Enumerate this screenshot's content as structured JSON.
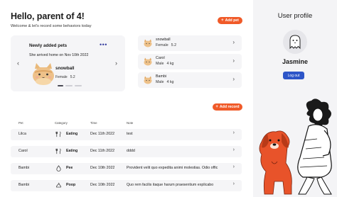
{
  "header": {
    "title": "Hello, parent of 4!",
    "subtitle": "Welcome & let's record some behaviors today",
    "add_pet_label": "Add pet"
  },
  "newly_added": {
    "title": "Newly added pets",
    "subtitle": "She arrived home on Nov 10th 2022",
    "pet_name": "snowball",
    "gender": "Female",
    "weight": "5.2",
    "icon": "cat-illustration"
  },
  "pets": [
    {
      "name": "snowball",
      "gender": "Female",
      "weight": "5.2"
    },
    {
      "name": "Carol",
      "gender": "Male",
      "weight": "4 kg"
    },
    {
      "name": "Bambi",
      "gender": "Male",
      "weight": "4 kg"
    }
  ],
  "records": {
    "add_label": "Add record",
    "columns": [
      "Pet",
      "Category",
      "Time",
      "Note"
    ],
    "rows": [
      {
        "pet": "Lilca",
        "category": "Eating",
        "time": "Dec 11th 2022",
        "note": "test",
        "icon": "fork-knife-icon"
      },
      {
        "pet": "Carol",
        "category": "Eating",
        "time": "Dec 11th 2022",
        "note": "dddd",
        "icon": "fork-knife-icon"
      },
      {
        "pet": "Bambi",
        "category": "Pee",
        "time": "Dec 10th 2022",
        "note": "Provident velit quo expedita animi molestias. Odio offic",
        "icon": "pee-icon"
      },
      {
        "pet": "Bambi",
        "category": "Poop",
        "time": "Dec 10th 2022",
        "note": "Quo rem facilis itaque harum praesentium explicabo",
        "icon": "poop-icon"
      }
    ]
  },
  "profile": {
    "title": "User profile",
    "name": "Jasmine",
    "logout_label": "Log out",
    "avatar_icon": "ghost-icon"
  },
  "colors": {
    "accent": "#f05a28",
    "primary": "#2d55c8",
    "card_bg": "#f5f5f7",
    "panel_bg": "#f4f4f6"
  }
}
